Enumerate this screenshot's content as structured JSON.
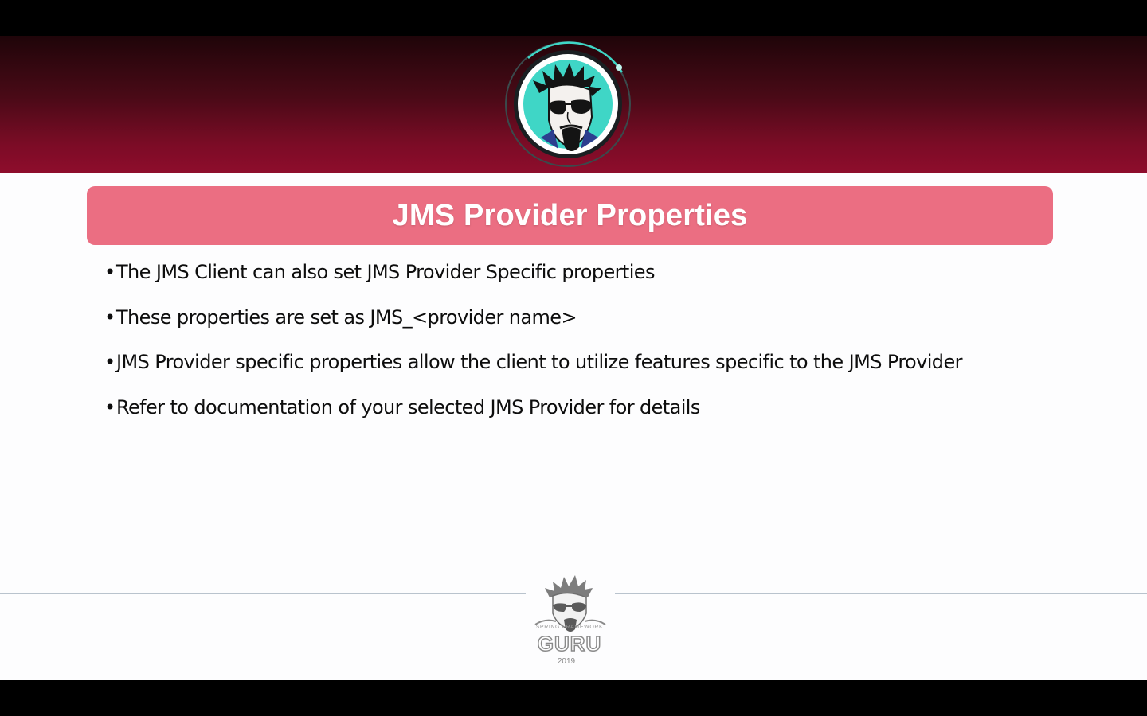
{
  "slide": {
    "title": "JMS Provider Properties",
    "bullets": [
      "The JMS Client can also set JMS Provider Specific properties",
      "These properties are set as JMS_<provider name>",
      "JMS Provider specific properties allow the client to utilize features specific to the JMS Provider",
      "Refer to documentation of your selected JMS Provider for details"
    ],
    "bullet_glyph": "•"
  },
  "footer": {
    "logo_tagline": "SPRING FRAMEWORK",
    "logo_wordmark": "GURU",
    "year": "2019"
  },
  "colors": {
    "header_dark": "#1f0509",
    "header_red": "#8e0d2c",
    "title_bar": "#eb6e82",
    "avatar_teal": "#3fd6c6"
  },
  "icons": {
    "header_avatar": "guru-avatar-icon",
    "footer_logo": "spring-framework-guru-logo"
  }
}
